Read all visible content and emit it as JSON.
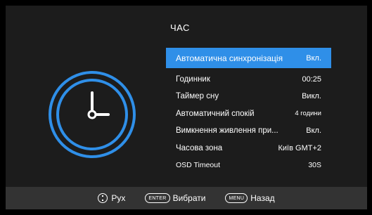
{
  "screen": {
    "title": "ЧАС",
    "accent_color": "#2f8fe8",
    "icon": "clock-icon"
  },
  "menu": {
    "items": [
      {
        "label": "Автоматична синхронізація",
        "value": "Вкл.",
        "selected": true
      },
      {
        "label": "Годинник",
        "value": "00:25"
      },
      {
        "label": "Таймер сну",
        "value": "Викл."
      },
      {
        "label": "Автоматичний спокій",
        "value": "4 години"
      },
      {
        "label": "Вимкнення живлення при...",
        "value": "Вкл."
      },
      {
        "label": "Часова зона",
        "value": "Київ GMT+2"
      },
      {
        "label": "OSD Timeout",
        "value": "30S"
      }
    ]
  },
  "footer": {
    "move_icon": "dpad-icon",
    "move_label": "Рух",
    "enter_key": "ENTER",
    "enter_label": "Вибрати",
    "menu_key": "MENU",
    "menu_label": "Назад"
  }
}
